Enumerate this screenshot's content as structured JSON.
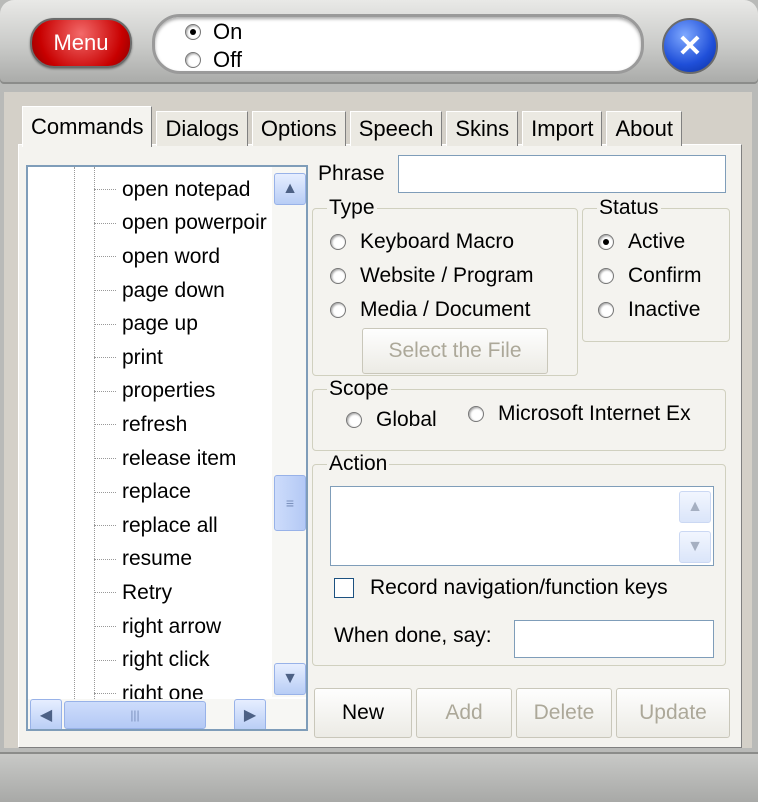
{
  "titlebar": {
    "menu_label": "Menu",
    "on_label": "On",
    "off_label": "Off",
    "selected": "On",
    "close_icon": "close-icon"
  },
  "tabs": [
    {
      "label": "Commands",
      "active": true
    },
    {
      "label": "Dialogs"
    },
    {
      "label": "Options"
    },
    {
      "label": "Speech"
    },
    {
      "label": "Skins"
    },
    {
      "label": "Import"
    },
    {
      "label": "About"
    }
  ],
  "commands": [
    "open notepad",
    "open powerpoir",
    "open word",
    "page down",
    "page up",
    "print",
    "properties",
    "refresh",
    "release item",
    "replace",
    "replace all",
    "resume",
    "Retry",
    "right arrow",
    "right click",
    "right one"
  ],
  "form": {
    "phrase_label": "Phrase",
    "phrase_value": "",
    "type": {
      "legend": "Type",
      "options": [
        "Keyboard Macro",
        "Website / Program",
        "Media / Document"
      ],
      "select_file_label": "Select the File"
    },
    "status": {
      "legend": "Status",
      "options": [
        "Active",
        "Confirm",
        "Inactive"
      ],
      "selected": "Active"
    },
    "scope": {
      "legend": "Scope",
      "options": [
        "Global",
        "Microsoft Internet Ex"
      ]
    },
    "action": {
      "legend": "Action",
      "value": "",
      "record_label": "Record navigation/function keys",
      "when_done_label": "When done, say:",
      "when_done_value": ""
    }
  },
  "buttons": {
    "new": "New",
    "add": "Add",
    "delete": "Delete",
    "update": "Update"
  }
}
